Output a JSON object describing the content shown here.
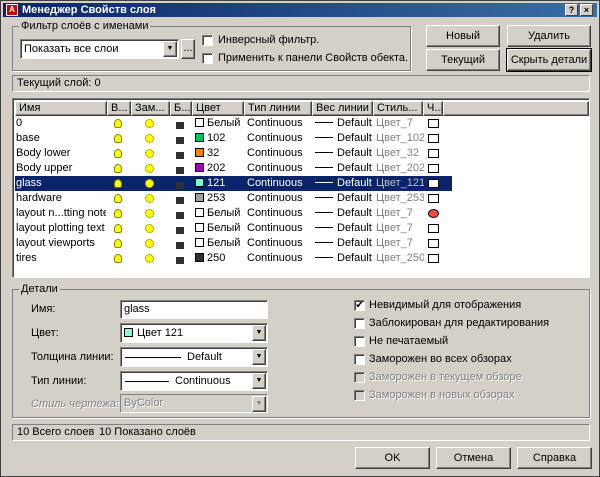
{
  "window": {
    "title": "Менеджер Свойств слоя",
    "help_btn": "?",
    "close_btn": "×"
  },
  "filter": {
    "group_title": "Фильтр слоёв с именами",
    "combo_value": "Показать все слои",
    "more_btn": "...",
    "invert_label": "Инверсный фильтр.",
    "apply_label": "Применить к панели Свойств обекта."
  },
  "buttons": {
    "new": "Новый",
    "delete": "Удалить",
    "current": "Текущий",
    "hide_details": "Скрыть детали",
    "ok": "OK",
    "cancel": "Отмена",
    "help": "Справка"
  },
  "current_layer": "Текущий слой:  0",
  "columns": [
    "Имя",
    "В...",
    "Зам...",
    "Б...",
    "Цвет",
    "Тип линии",
    "Вес линии",
    "Стиль...",
    "Ч..."
  ],
  "rows": [
    {
      "name": "0",
      "color": "Белый",
      "color_hex": "#ffffff",
      "linetype": "Continuous",
      "weight": "Default",
      "style": "Цвет_7",
      "print": "yes",
      "selected": false
    },
    {
      "name": "base",
      "color": "102",
      "color_hex": "#00c060",
      "linetype": "Continuous",
      "weight": "Default",
      "style": "Цвет_102",
      "print": "yes",
      "selected": false
    },
    {
      "name": "Body lower",
      "color": "32",
      "color_hex": "#ff8000",
      "linetype": "Continuous",
      "weight": "Default",
      "style": "Цвет_32",
      "print": "yes",
      "selected": false
    },
    {
      "name": "Body upper",
      "color": "202",
      "color_hex": "#a000c0",
      "linetype": "Continuous",
      "weight": "Default",
      "style": "Цвет_202",
      "print": "yes",
      "selected": false
    },
    {
      "name": "glass",
      "color": "121",
      "color_hex": "#80ffd0",
      "linetype": "Continuous",
      "weight": "Default",
      "style": "Цвет_121",
      "print": "yes",
      "selected": true
    },
    {
      "name": "hardware",
      "color": "253",
      "color_hex": "#a0a0a0",
      "linetype": "Continuous",
      "weight": "Default",
      "style": "Цвет_253",
      "print": "yes",
      "selected": false
    },
    {
      "name": "layout n...tting notes",
      "color": "Белый",
      "color_hex": "#ffffff",
      "linetype": "Continuous",
      "weight": "Default",
      "style": "Цвет_7",
      "print": "no",
      "selected": false
    },
    {
      "name": "layout plotting text",
      "color": "Белый",
      "color_hex": "#ffffff",
      "linetype": "Continuous",
      "weight": "Default",
      "style": "Цвет_7",
      "print": "yes",
      "selected": false
    },
    {
      "name": "layout viewports",
      "color": "Белый",
      "color_hex": "#ffffff",
      "linetype": "Continuous",
      "weight": "Default",
      "style": "Цвет_7",
      "print": "yes",
      "selected": false
    },
    {
      "name": "tires",
      "color": "250",
      "color_hex": "#303030",
      "linetype": "Continuous",
      "weight": "Default",
      "style": "Цвет_250",
      "print": "yes",
      "selected": false
    }
  ],
  "details": {
    "group_title": "Детали",
    "name_label": "Имя:",
    "name_value": "glass",
    "color_label": "Цвет:",
    "color_value": "Цвет 121",
    "lineweight_label": "Толщина линии:",
    "lineweight_value": "Default",
    "linetype_label": "Тип линии:",
    "linetype_value": "Continuous",
    "plotstyle_label": "Стиль чертежа:",
    "plotstyle_value": "ByColor",
    "checks": [
      {
        "label": "Невидимый для отображения",
        "checked": true,
        "enabled": true
      },
      {
        "label": "Заблокирован для редактирования",
        "checked": false,
        "enabled": true
      },
      {
        "label": "Не печатаемый",
        "checked": false,
        "enabled": true
      },
      {
        "label": "Заморожен во всех обзорах",
        "checked": false,
        "enabled": true
      },
      {
        "label": "Заморожен в текущем обзоре",
        "checked": false,
        "enabled": false
      },
      {
        "label": "Заморожен в новых обзорах",
        "checked": false,
        "enabled": false
      }
    ]
  },
  "status": {
    "total": "10 Всего слоев",
    "shown": "10 Показано слоёв"
  }
}
